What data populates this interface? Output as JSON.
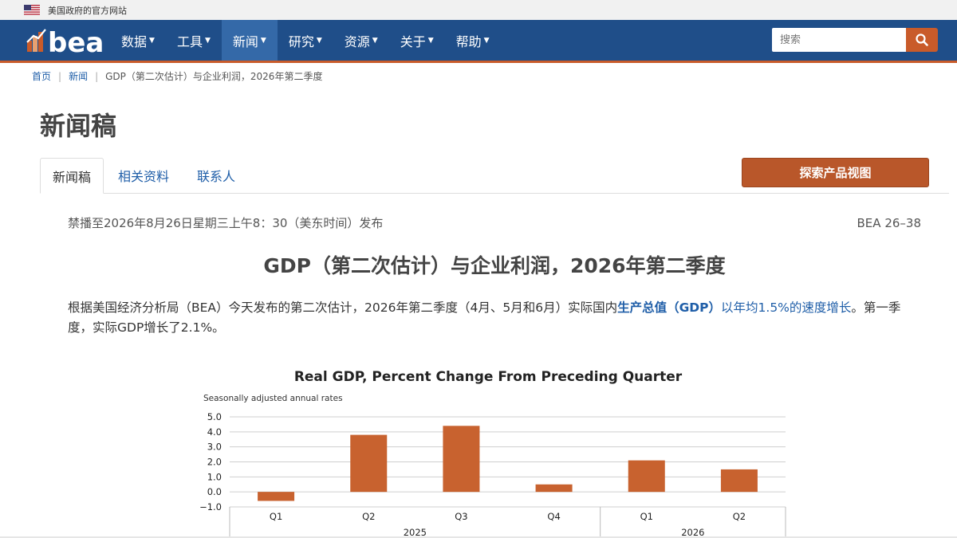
{
  "gov_banner": {
    "text": "美国政府的官方网站",
    "flag_icon": "us-flag-icon"
  },
  "nav": {
    "logo_text": "bea",
    "items": [
      {
        "label": "数据",
        "active": false
      },
      {
        "label": "工具",
        "active": false
      },
      {
        "label": "新闻",
        "active": true
      },
      {
        "label": "研究",
        "active": false
      },
      {
        "label": "资源",
        "active": false
      },
      {
        "label": "关于",
        "active": false
      },
      {
        "label": "帮助",
        "active": false
      }
    ],
    "search_placeholder": "搜索",
    "search_icon": "magnifier-icon",
    "colors": {
      "bar": "#1f4e89",
      "active": "#3469a8",
      "accent": "#c95b2a"
    }
  },
  "breadcrumb": {
    "home": "首页",
    "news": "新闻",
    "current": "GDP（第二次估计）与企业利润，2026年第二季度"
  },
  "page_title": "新闻稿",
  "tabs": [
    {
      "label": "新闻稿",
      "active": true
    },
    {
      "label": "相关资料",
      "active": false
    },
    {
      "label": "联系人",
      "active": false
    }
  ],
  "explore_button": "探索产品视图",
  "release": {
    "embargo": "禁播至2026年8月26日星期三上午8：30（美东时间）发布",
    "number": "BEA 26–38",
    "title": "GDP（第二次估计）与企业利润，2026年第二季度",
    "summary_part1": "根据美国经济分析局（BEA）今天发布的第二次估计，2026年第二季度（4月、5月和6月）实际国内",
    "summary_link_bold": "生产总值（GDP）",
    "summary_link_rest": "以年均1.5%的速度增长",
    "summary_part2": "。第一季度，实际GDP增长了2.1%。"
  },
  "chart_data": {
    "type": "bar",
    "title": "Real GDP, Percent Change From Preceding Quarter",
    "subtitle": "Seasonally adjusted annual rates",
    "categories": [
      "Q1",
      "Q2",
      "Q3",
      "Q4",
      "Q1",
      "Q2"
    ],
    "groups": [
      {
        "label": "2025",
        "categories": [
          "Q1",
          "Q2",
          "Q3",
          "Q4"
        ]
      },
      {
        "label": "2026",
        "categories": [
          "Q1",
          "Q2"
        ]
      }
    ],
    "values": [
      -0.6,
      3.8,
      4.4,
      0.5,
      2.1,
      1.5
    ],
    "yticks": [
      "5.0",
      "4.0",
      "3.0",
      "2.0",
      "1.0",
      "0.0",
      "−1.0"
    ],
    "ylim": [
      -1.0,
      5.0
    ],
    "grid": true,
    "bar_color": "#c8622f"
  }
}
